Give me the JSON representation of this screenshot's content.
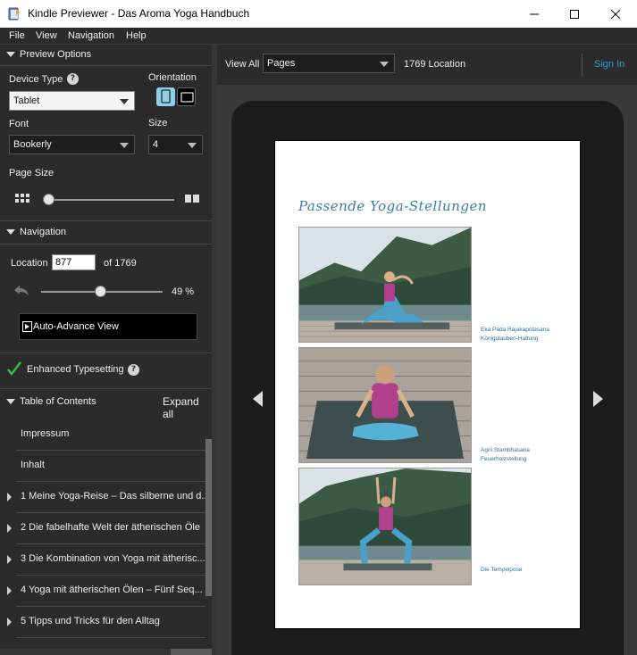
{
  "window": {
    "title": "Kindle Previewer - Das Aroma Yoga Handbuch"
  },
  "menu": [
    "File",
    "View",
    "Navigation",
    "Help"
  ],
  "preview_options": {
    "header": "Preview Options",
    "device_type_label": "Device Type",
    "device_type_value": "Tablet",
    "orientation_label": "Orientation",
    "font_label": "Font",
    "font_value": "Bookerly",
    "size_label": "Size",
    "size_value": "4",
    "page_size_label": "Page Size",
    "page_size_level": 0.05
  },
  "navigation": {
    "header": "Navigation",
    "location_label": "Location",
    "location_value": "877",
    "of_total": "of 1769",
    "progress_percent": "49 %",
    "progress_fraction": 0.49,
    "auto_advance_label": "Auto-Advance View"
  },
  "enhanced_typesetting": {
    "label": "Enhanced Typesetting"
  },
  "toc": {
    "header": "Table of Contents",
    "expand_all": "Expand all",
    "items": [
      {
        "label": "Impressum",
        "expandable": false
      },
      {
        "label": "Inhalt",
        "expandable": false
      },
      {
        "label": "1 Meine Yoga-Reise – Das silberne und d...",
        "expandable": true
      },
      {
        "label": "2 Die fabelhafte Welt der ätherischen Öle",
        "expandable": true
      },
      {
        "label": "3 Die Kombination von Yoga mit ätherisc...",
        "expandable": true
      },
      {
        "label": "4 Yoga mit ätherischen Ölen – Fünf Seq...",
        "expandable": true
      },
      {
        "label": "5 Tipps und Tricks für den Alltag",
        "expandable": true
      }
    ]
  },
  "toolbar": {
    "view_all_label": "View All",
    "view_mode_value": "Pages",
    "location_text": "1769 Location",
    "sign_in": "Sign In"
  },
  "page": {
    "heading": "Passende Yoga-Stellungen",
    "captions": [
      {
        "line1": "Eka Pada Rajakapotasana",
        "line2": "Königstauben-Haltung"
      },
      {
        "line1": "Agni Stambhasana",
        "line2": "Feuerholzstellung"
      },
      {
        "line1": "Die Tempelpose",
        "line2": ""
      }
    ]
  },
  "colors": {
    "accent": "#2f9bd6",
    "panel_bg": "#2b2b2b",
    "caption_blue": "#2a6f9a",
    "check_green": "#35c13a"
  }
}
